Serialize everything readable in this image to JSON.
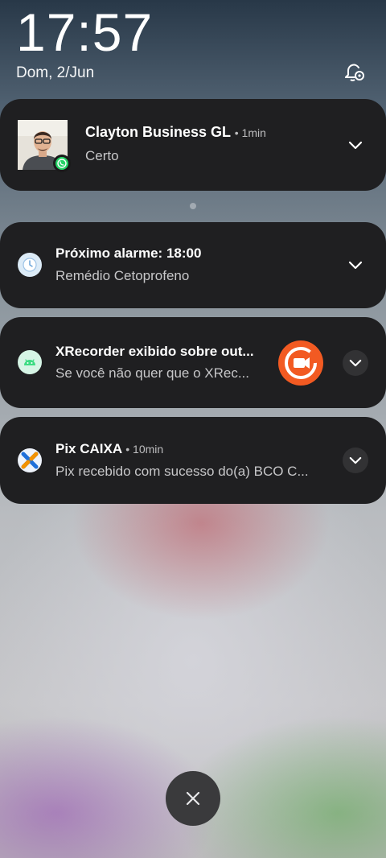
{
  "lockscreen": {
    "time": "17:57",
    "date": "Dom, 2/Jun"
  },
  "notifications": [
    {
      "app": "WhatsApp",
      "title": "Clayton Business GL",
      "time": "1min",
      "text": "Certo",
      "icon": "avatar-photo"
    },
    {
      "app": "Clock",
      "title": "Próximo alarme: 18:00",
      "time": "",
      "text": "Remédio Cetoprofeno",
      "icon": "alarm-clock-icon"
    },
    {
      "app": "Android System",
      "title": "XRecorder exibido sobre out...",
      "time": "",
      "text": "Se você não quer que o XRec...",
      "icon": "android-icon",
      "thumbnail": "xrecorder-logo"
    },
    {
      "app": "CAIXA",
      "title": "Pix CAIXA",
      "time": "10min",
      "text": "Pix recebido com sucesso do(a) BCO C...",
      "icon": "caixa-x-icon"
    }
  ],
  "colors": {
    "card_bg": "#1f1f21",
    "whatsapp_green": "#25d366",
    "xrecorder_orange": "#f25a22",
    "caixa_blue": "#1e6fd9",
    "caixa_orange": "#f39200"
  },
  "controls": {
    "clear_all": "close-icon"
  }
}
